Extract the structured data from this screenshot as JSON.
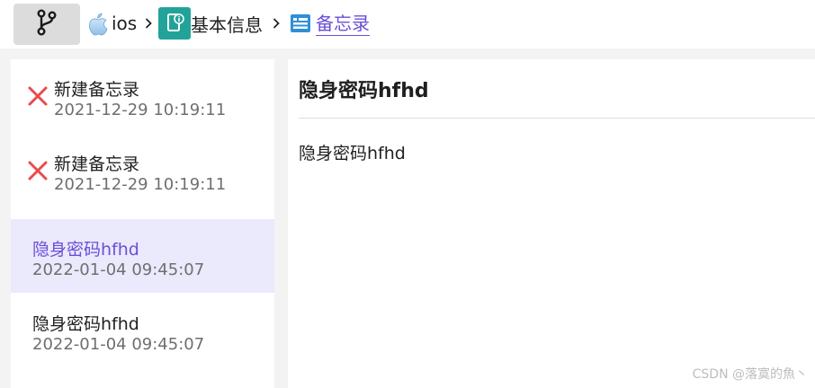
{
  "breadcrumb": {
    "branch_icon": "git-branch-icon",
    "items": [
      {
        "label": "ios",
        "icon": "apple-icon"
      },
      {
        "label": "基本信息",
        "icon": "info-document-icon"
      },
      {
        "label": "备忘录",
        "icon": "memo-list-icon",
        "active": true
      }
    ],
    "separator_icon": "chevron-right-icon"
  },
  "memo_list": {
    "items": [
      {
        "title": "新建备忘录",
        "time": "2021-12-29 10:19:11",
        "status_icon": "close-icon"
      },
      {
        "title": "新建备忘录",
        "time": "2021-12-29 10:19:11",
        "status_icon": "close-icon"
      },
      {
        "title": "隐身密码hfhd",
        "time": "2022-01-04 09:45:07",
        "selected": true
      },
      {
        "title": "隐身密码hfhd",
        "time": "2022-01-04 09:45:07"
      }
    ]
  },
  "detail": {
    "title": "隐身密码hfhd",
    "body": "隐身密码hfhd"
  },
  "watermark": "CSDN @落寞的魚丶",
  "colors": {
    "accent": "#6b4fd8",
    "selected_bg": "#ebe9fc",
    "info_icon_bg": "#22a39a",
    "error_red": "#e84c4c",
    "memo_icon_blue": "#2f8fd8"
  }
}
